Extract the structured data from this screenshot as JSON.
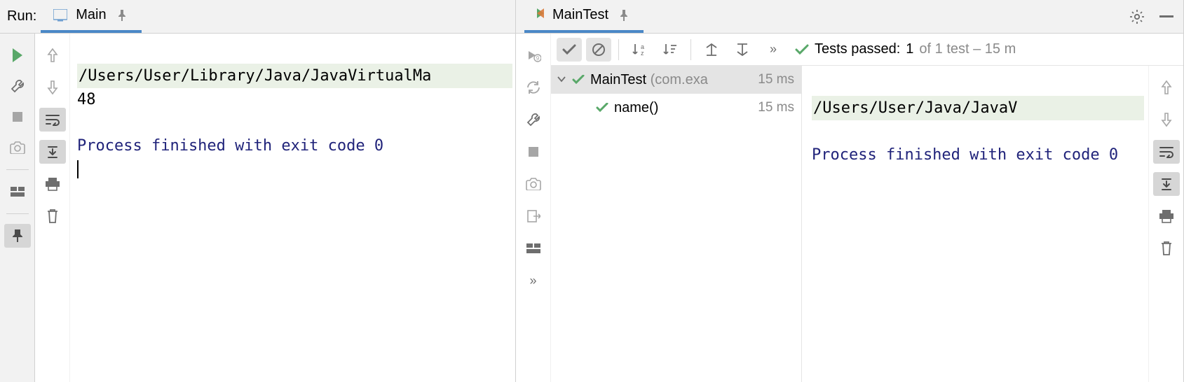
{
  "leftPanel": {
    "runLabel": "Run:",
    "tab": {
      "title": "Main"
    },
    "console": {
      "command": "/Users/User/Library/Java/JavaVirtualMa",
      "output": "48",
      "exitMessage": "Process finished with exit code 0"
    }
  },
  "rightPanel": {
    "tab": {
      "title": "MainTest"
    },
    "status": {
      "prefix": "Tests passed:",
      "passed": "1",
      "suffix": "of 1 test – 15 m"
    },
    "tree": {
      "root": {
        "name": "MainTest",
        "package": "(com.exa",
        "time": "15 ms"
      },
      "child": {
        "name": "name()",
        "time": "15 ms"
      }
    },
    "console": {
      "command": "/Users/User/Java/JavaV",
      "exitMessage": "Process finished with exit code 0"
    }
  }
}
